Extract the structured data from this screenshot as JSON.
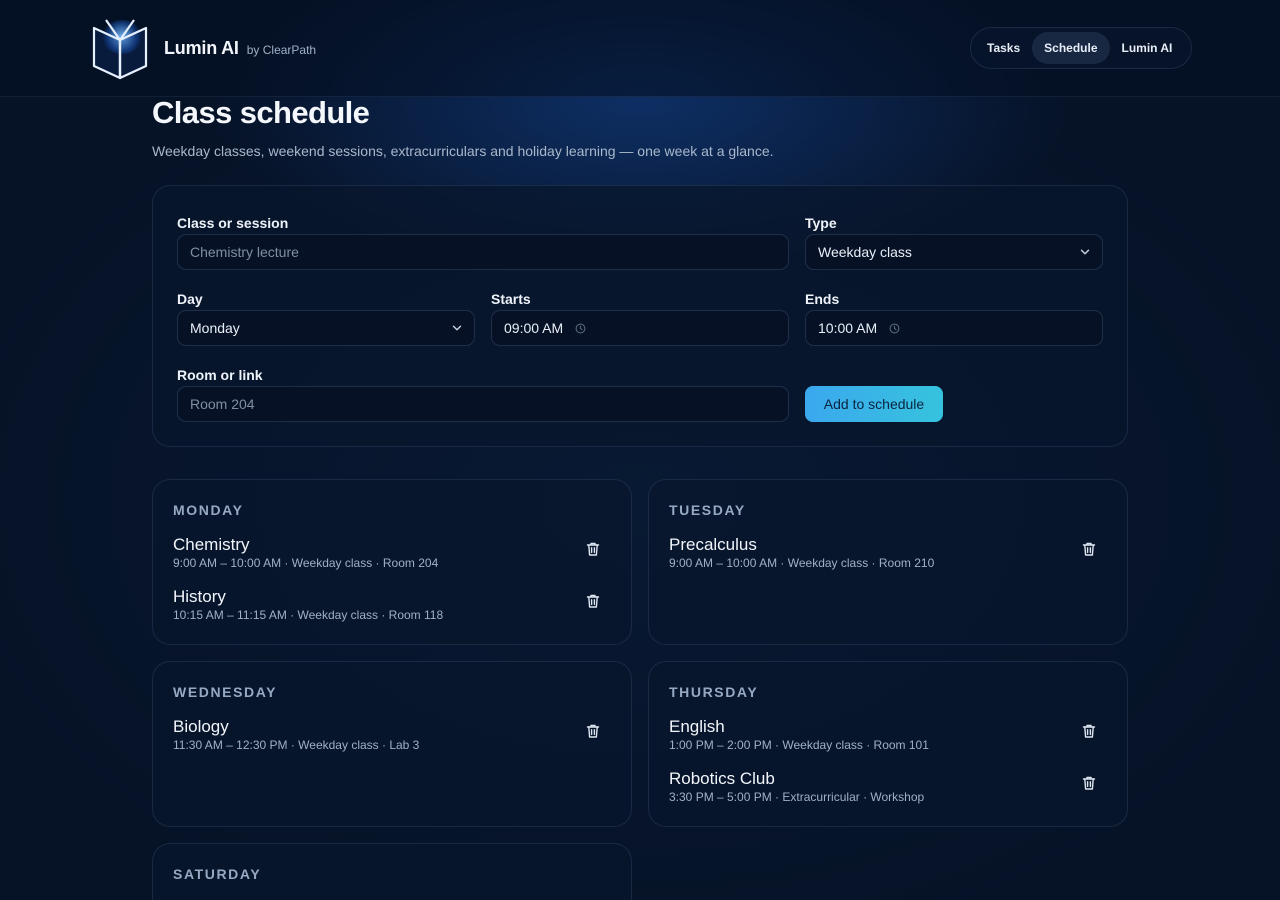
{
  "header": {
    "brand_name": "Lumin AI",
    "brand_by": "by ClearPath",
    "nav": [
      {
        "label": "Tasks",
        "active": false
      },
      {
        "label": "Schedule",
        "active": true
      },
      {
        "label": "Lumin AI",
        "active": false
      }
    ]
  },
  "page": {
    "title": "Class schedule",
    "subtitle": "Weekday classes, weekend sessions, extracurriculars and holiday learning — one week at a glance."
  },
  "form": {
    "class_label": "Class or session",
    "class_placeholder": "Chemistry lecture",
    "type_label": "Type",
    "type_value": "Weekday class",
    "day_label": "Day",
    "day_value": "Monday",
    "starts_label": "Starts",
    "starts_value": "09:00 AM",
    "ends_label": "Ends",
    "ends_value": "10:00 AM",
    "room_label": "Room or link",
    "room_placeholder": "Room 204",
    "submit_label": "Add to schedule"
  },
  "days": [
    {
      "name": "MONDAY",
      "entries": [
        {
          "title": "Chemistry",
          "meta": "9:00 AM – 10:00 AM · Weekday class · Room 204"
        },
        {
          "title": "History",
          "meta": "10:15 AM – 11:15 AM · Weekday class · Room 118"
        }
      ]
    },
    {
      "name": "TUESDAY",
      "entries": [
        {
          "title": "Precalculus",
          "meta": "9:00 AM – 10:00 AM · Weekday class · Room 210"
        }
      ]
    },
    {
      "name": "WEDNESDAY",
      "entries": [
        {
          "title": "Biology",
          "meta": "11:30 AM – 12:30 PM · Weekday class · Lab 3"
        }
      ]
    },
    {
      "name": "THURSDAY",
      "entries": [
        {
          "title": "English",
          "meta": "1:00 PM – 2:00 PM · Weekday class · Room 101"
        },
        {
          "title": "Robotics Club",
          "meta": "3:30 PM – 5:00 PM · Extracurricular · Workshop"
        }
      ]
    },
    {
      "name": "SATURDAY",
      "entries": []
    }
  ],
  "icons": {
    "logo": "open-book-logo-icon",
    "select": "chevron-down-icon",
    "time": "clock-icon",
    "delete": "trash-icon"
  },
  "colors": {
    "background": "#061226",
    "accent": "#3ba8ee",
    "accent_end": "#36c3de"
  }
}
